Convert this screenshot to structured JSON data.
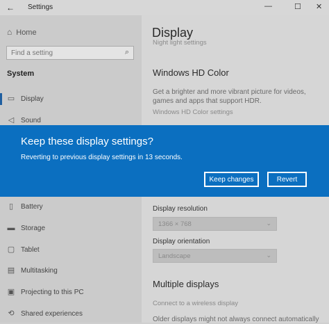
{
  "window": {
    "title": "Settings",
    "back_icon": "back-arrow-icon",
    "controls": [
      "minimize-icon",
      "maximize-icon",
      "close-icon"
    ]
  },
  "sidebar": {
    "home_label": "Home",
    "search_placeholder": "Find a setting",
    "section_title": "System",
    "items": [
      {
        "label": "Display",
        "icon": "display-icon",
        "active": true
      },
      {
        "label": "Sound",
        "icon": "sound-icon"
      },
      {
        "label": "Battery",
        "icon": "battery-icon"
      },
      {
        "label": "Storage",
        "icon": "storage-icon"
      },
      {
        "label": "Tablet",
        "icon": "tablet-icon"
      },
      {
        "label": "Multitasking",
        "icon": "multitasking-icon"
      },
      {
        "label": "Projecting to this PC",
        "icon": "projecting-icon"
      },
      {
        "label": "Shared experiences",
        "icon": "shared-experiences-icon"
      }
    ]
  },
  "content": {
    "title": "Display",
    "night_light_link": "Night light settings",
    "hd_color": {
      "heading": "Windows HD Color",
      "description": "Get a brighter and more vibrant picture for videos, games and apps that support HDR.",
      "link": "Windows HD Color settings"
    },
    "resolution": {
      "label": "Display resolution",
      "value": "1366 × 768"
    },
    "orientation": {
      "label": "Display orientation",
      "value": "Landscape"
    },
    "multiple_displays": {
      "heading": "Multiple displays",
      "link": "Connect to a wireless display",
      "note": "Older displays might not always connect automatically"
    }
  },
  "dialog": {
    "title": "Keep these display settings?",
    "message": "Reverting to previous display settings in 13 seconds.",
    "keep_label": "Keep changes",
    "revert_label": "Revert",
    "background": "#0b6fc0"
  },
  "colors": {
    "accent": "#0b6fc0",
    "overlay": "#cfcfcf"
  }
}
